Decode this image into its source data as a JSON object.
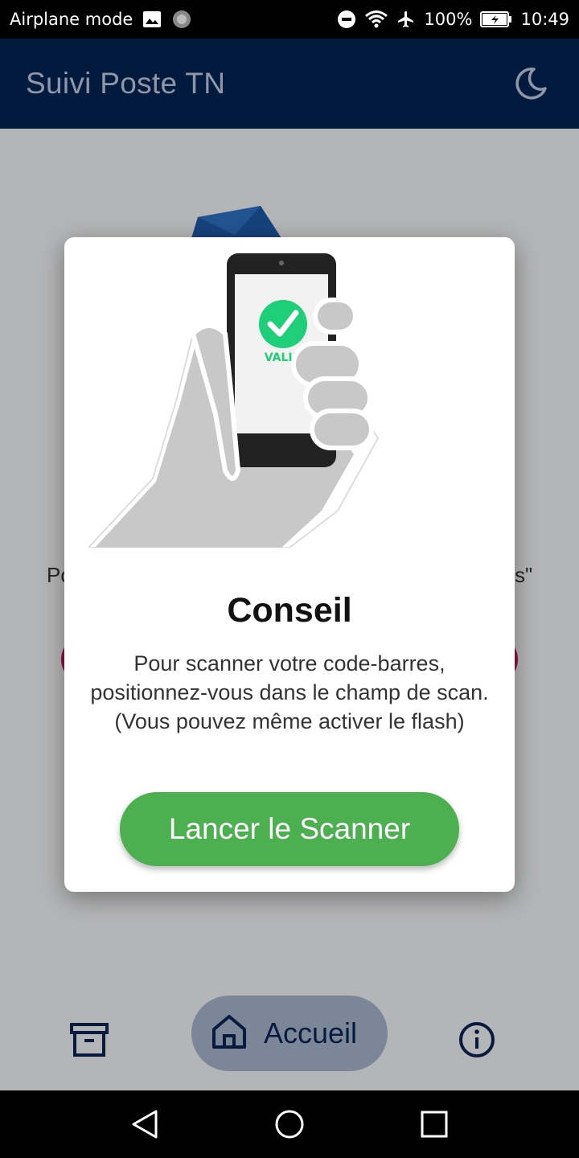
{
  "status_bar": {
    "airplane_label": "Airplane mode",
    "battery": "100%",
    "time": "10:49",
    "icons": [
      "image-icon",
      "loading-icon",
      "do-not-disturb-icon",
      "wifi-icon",
      "airplane-icon",
      "battery-charging-icon"
    ]
  },
  "appbar": {
    "title": "Suivi Poste TN",
    "theme_icon": "moon-icon"
  },
  "background": {
    "text_left": "Po",
    "text_right": "s\"",
    "bottom_nav": {
      "archive_icon": "archive-icon",
      "home_label": "Accueil",
      "home_icon": "home-icon",
      "info_icon": "info-icon"
    }
  },
  "dialog": {
    "illustration_label": "VALID",
    "title": "Conseil",
    "body_line1": "Pour scanner votre code-barres,",
    "body_line2": "positionnez-vous dans le champ de scan.",
    "body_line3": "(Vous pouvez même activer le flash)",
    "button_label": "Lancer le Scanner"
  },
  "colors": {
    "appbar_bg": "#011a3d",
    "accent_green": "#4caf50",
    "nav_pill": "#a7b7cf",
    "valid_green": "#1ecf7a"
  }
}
